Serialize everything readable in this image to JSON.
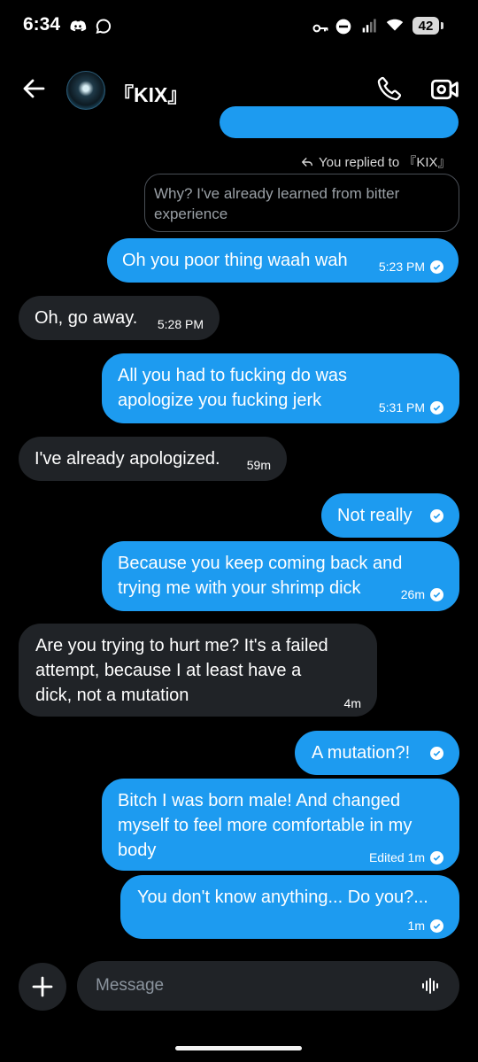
{
  "status_bar": {
    "time": "6:34",
    "battery": "42"
  },
  "header": {
    "contact_name": "『KIX』"
  },
  "reply_context": {
    "label": "You replied to 『KIX』",
    "quoted_text": "Why? I've already learned from bitter experience"
  },
  "messages": [
    {
      "side": "sent",
      "lines": [
        "Oh you poor thing waah wah"
      ],
      "time": "5:23 PM",
      "read": true
    },
    {
      "side": "received",
      "lines": [
        "Oh, go away."
      ],
      "time": "5:28 PM"
    },
    {
      "side": "sent",
      "lines": [
        "All you had to fucking do was",
        "apologize you fucking jerk"
      ],
      "time": "5:31 PM",
      "read": true
    },
    {
      "side": "received",
      "lines": [
        "I've already apologized."
      ],
      "time": "59m"
    },
    {
      "side": "sent",
      "lines": [
        "Not really"
      ],
      "time": "",
      "read": true
    },
    {
      "side": "sent",
      "lines": [
        "Because you keep coming back and",
        "trying me with your shrimp dick"
      ],
      "time": "26m",
      "read": true
    },
    {
      "side": "received",
      "lines": [
        "Are you trying to hurt me? It's a failed",
        "attempt, because I at least have a",
        "dick, not a mutation"
      ],
      "time": "4m"
    },
    {
      "side": "sent",
      "lines": [
        "A mutation?!"
      ],
      "time": "",
      "read": true
    },
    {
      "side": "sent",
      "lines": [
        "Bitch I was born male! And changed",
        "myself to feel more comfortable in my",
        "body"
      ],
      "time": "Edited 1m",
      "read": true
    },
    {
      "side": "sent",
      "lines": [
        "You don't know anything... Do you?..."
      ],
      "time": "1m",
      "read": true
    }
  ],
  "composer": {
    "placeholder": "Message"
  },
  "colors": {
    "sent_bubble": "#1d9bf0",
    "received_bubble": "#202327",
    "background": "#000000"
  }
}
